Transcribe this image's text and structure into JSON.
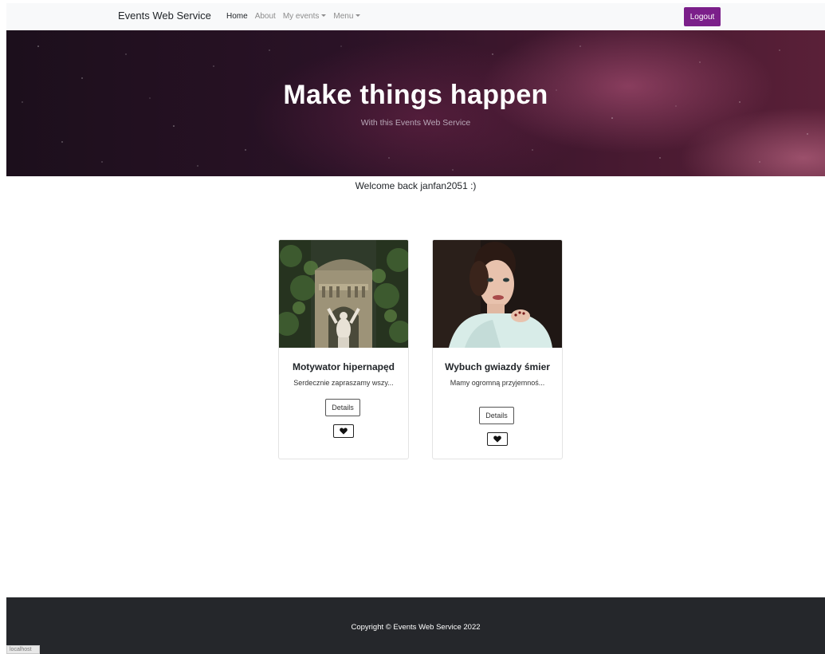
{
  "navbar": {
    "brand": "Events Web Service",
    "links": [
      {
        "label": "Home",
        "active": true
      },
      {
        "label": "About",
        "active": false
      },
      {
        "label": "My events",
        "active": false
      },
      {
        "label": "Menu",
        "active": false
      }
    ],
    "logout_label": "Logout",
    "accent_color": "#7b1f8a"
  },
  "hero": {
    "title": "Make things happen",
    "subtitle": "With this Events Web Service"
  },
  "welcome": "Welcome back janfan2051 :)",
  "events": [
    {
      "title": "Motywator hipernapęd",
      "excerpt": "Serdecznie zapraszamy wszy...",
      "details_label": "Details",
      "favorite_icon": "heart-icon"
    },
    {
      "title": "Wybuch gwiazdy śmier",
      "excerpt": "Mamy ogromną przyjemnoś...",
      "details_label": "Details",
      "favorite_icon": "heart-icon"
    }
  ],
  "footer": {
    "copyright": "Copyright © Events Web Service 2022"
  },
  "status_bar": "localhost"
}
